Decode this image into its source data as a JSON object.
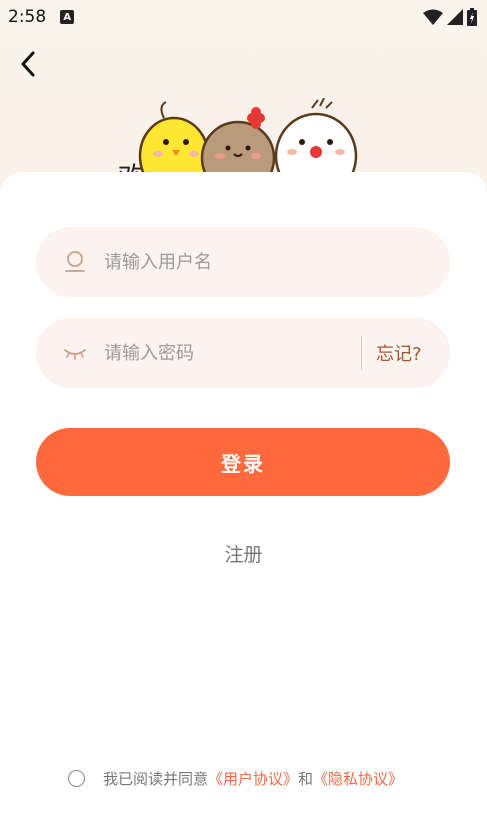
{
  "status_bar": {
    "time": "2:58",
    "notification_glyph": "A"
  },
  "header": {
    "back_icon": "chevron-left-icon",
    "welcome_text": "欢"
  },
  "form": {
    "username_placeholder": "请输入用户名",
    "password_placeholder": "请输入密码",
    "forgot_label": "忘记?",
    "login_label": "登录",
    "register_label": "注册"
  },
  "agreement": {
    "prefix": "我已阅读并同意",
    "user_agreement": "《用户协议》",
    "conjunction": "和",
    "privacy_policy": "《隐私协议》"
  },
  "colors": {
    "accent": "#ff6a3d",
    "input_bg": "#fdf3ee",
    "link": "#f26a45",
    "forgot": "#9b5a35"
  }
}
